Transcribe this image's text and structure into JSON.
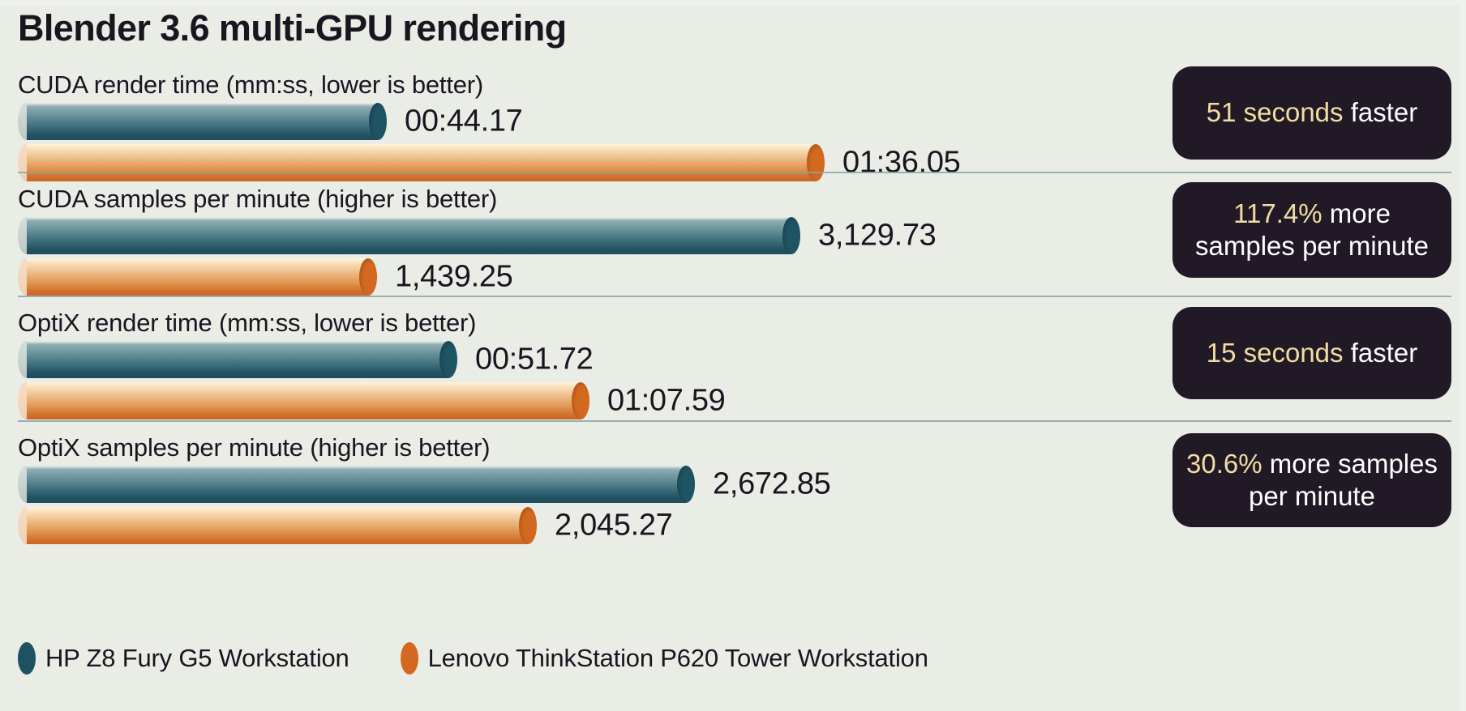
{
  "title": "Blender 3.6 multi-GPU rendering",
  "colors": {
    "background": "#e9ede6",
    "teal": "#1e5162",
    "orange": "#d3691f",
    "callout_bg": "#211a26",
    "callout_highlight": "#f2dda2",
    "text": "#191520",
    "divider": "#8ea3a5"
  },
  "legend": {
    "items": [
      {
        "label": "HP Z8 Fury G5 Workstation",
        "color": "teal"
      },
      {
        "label": "Lenovo ThinkStation P620 Tower Workstation",
        "color": "orange"
      }
    ]
  },
  "sections": [
    {
      "label": "CUDA render time (mm:ss, lower is better)",
      "bars": [
        {
          "series": "HP Z8 Fury G5 Workstation",
          "value_label": "00:44.17",
          "value": 44.17,
          "color": "teal"
        },
        {
          "series": "Lenovo ThinkStation P620 Tower Workstation",
          "value_label": "01:36.05",
          "value": 96.05,
          "color": "orange"
        }
      ],
      "callout": {
        "highlight": "51 seconds",
        "rest": "faster"
      }
    },
    {
      "label": "CUDA samples per minute (higher is better)",
      "bars": [
        {
          "series": "HP Z8 Fury G5 Workstation",
          "value_label": "3,129.73",
          "value": 3129.73,
          "color": "teal"
        },
        {
          "series": "Lenovo ThinkStation P620 Tower Workstation",
          "value_label": "1,439.25",
          "value": 1439.25,
          "color": "orange"
        }
      ],
      "callout": {
        "highlight": "117.4%",
        "rest": "more samples per minute"
      }
    },
    {
      "label": "OptiX render time (mm:ss, lower is better)",
      "bars": [
        {
          "series": "HP Z8 Fury G5 Workstation",
          "value_label": "00:51.72",
          "value": 51.72,
          "color": "teal"
        },
        {
          "series": "Lenovo ThinkStation P620 Tower Workstation",
          "value_label": "01:07.59",
          "value": 67.59,
          "color": "orange"
        }
      ],
      "callout": {
        "highlight": "15 seconds",
        "rest": "faster"
      }
    },
    {
      "label": "OptiX samples per minute (higher is better)",
      "bars": [
        {
          "series": "HP Z8 Fury G5 Workstation",
          "value_label": "2,672.85",
          "value": 2672.85,
          "color": "teal"
        },
        {
          "series": "Lenovo ThinkStation P620 Tower Workstation",
          "value_label": "2,045.27",
          "value": 2045.27,
          "color": "orange"
        }
      ],
      "callout": {
        "highlight": "30.6%",
        "rest": "more samples per minute"
      }
    }
  ],
  "chart_data": {
    "type": "bar",
    "title": "Blender 3.6 multi-GPU rendering",
    "orientation": "horizontal",
    "grid": false,
    "legend_position": "bottom-left",
    "xlabel": "",
    "ylabel": "",
    "series": [
      {
        "name": "HP Z8 Fury G5 Workstation",
        "color": "#1e5162"
      },
      {
        "name": "Lenovo ThinkStation P620 Tower Workstation",
        "color": "#d3691f"
      }
    ],
    "groups": [
      {
        "category": "CUDA render time (mm:ss, lower is better)",
        "unit": "mm:ss",
        "better": "lower",
        "values": [
          44.17,
          96.05
        ],
        "labels": [
          "00:44.17",
          "01:36.05"
        ],
        "annotation": "51 seconds faster"
      },
      {
        "category": "CUDA samples per minute (higher is better)",
        "unit": "samples per minute",
        "better": "higher",
        "values": [
          3129.73,
          1439.25
        ],
        "labels": [
          "3,129.73",
          "1,439.25"
        ],
        "annotation": "117.4% more samples per minute"
      },
      {
        "category": "OptiX render time (mm:ss, lower is better)",
        "unit": "mm:ss",
        "better": "lower",
        "values": [
          51.72,
          67.59
        ],
        "labels": [
          "00:51.72",
          "01:07.59"
        ],
        "annotation": "15 seconds faster"
      },
      {
        "category": "OptiX samples per minute (higher is better)",
        "unit": "samples per minute",
        "better": "higher",
        "values": [
          2672.85,
          2045.27
        ],
        "labels": [
          "2,672.85",
          "2,045.27"
        ],
        "annotation": "30.6% more samples per minute"
      }
    ]
  }
}
